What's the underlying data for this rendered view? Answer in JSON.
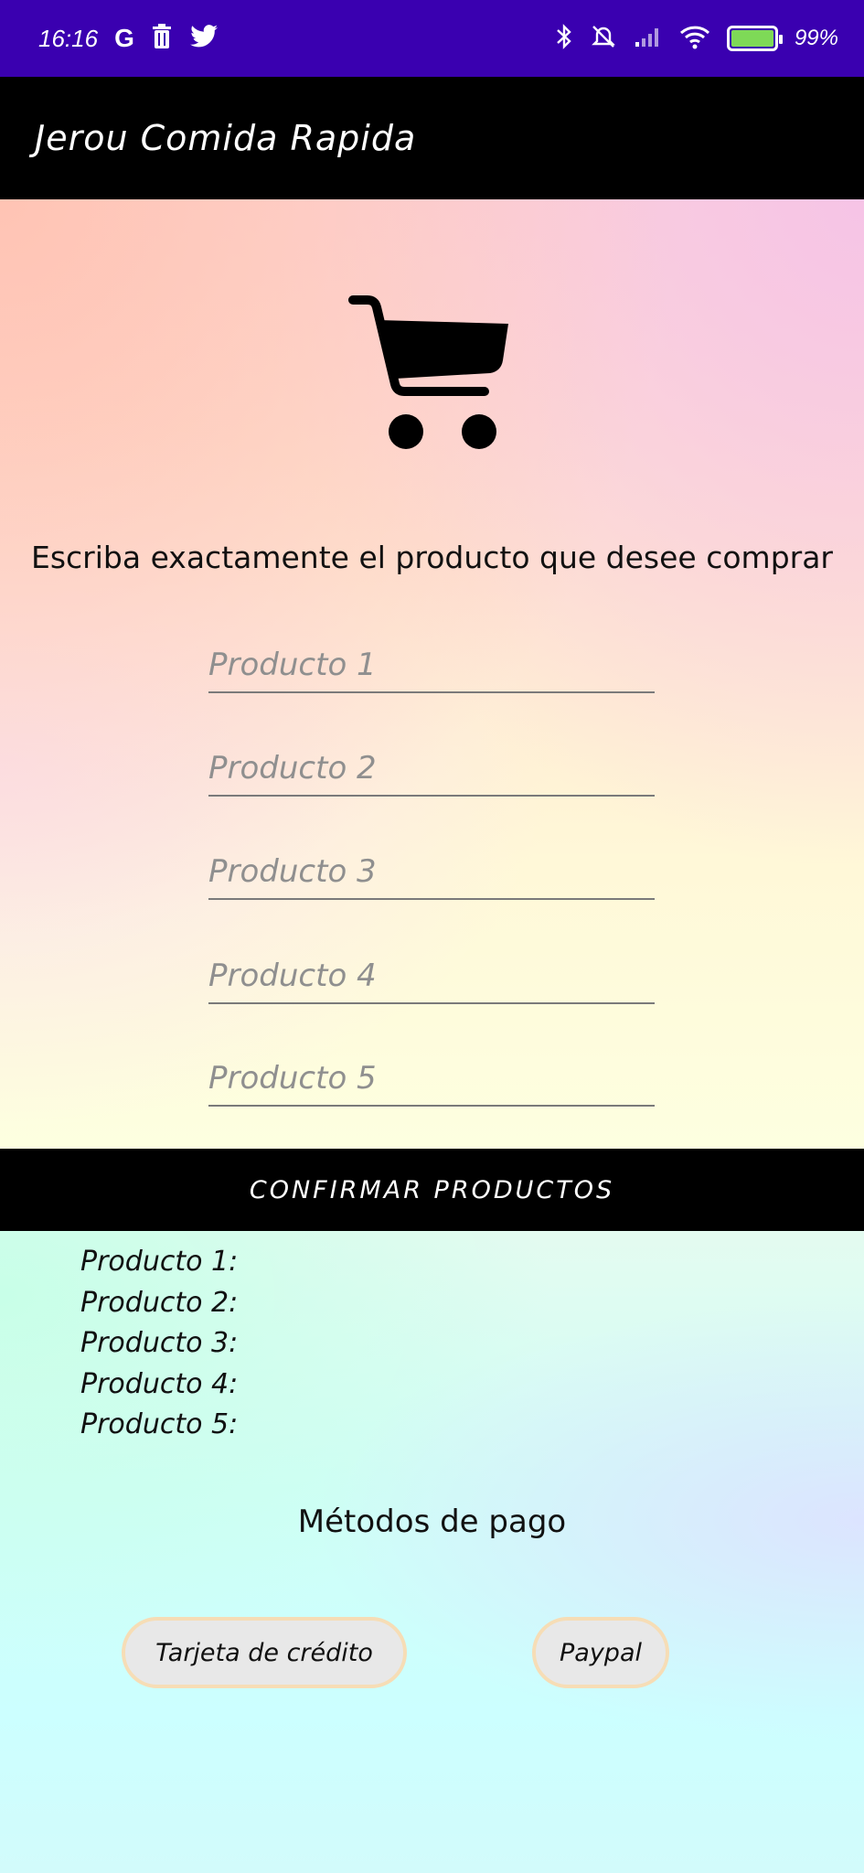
{
  "status_bar": {
    "time": "16:16",
    "notif_icons": [
      "G",
      "trash-icon",
      "twitter-icon"
    ],
    "battery": "99%",
    "battery_color": "#7ed957",
    "bg_color": "#3a00b0"
  },
  "app_bar": {
    "title": "Jerou Comida Rapida"
  },
  "main": {
    "instruction": "Escriba exactamente el producto que desee comprar",
    "fields": [
      {
        "placeholder": "Producto 1",
        "value": ""
      },
      {
        "placeholder": "Producto 2",
        "value": ""
      },
      {
        "placeholder": "Producto 3",
        "value": ""
      },
      {
        "placeholder": "Producto 4",
        "value": ""
      },
      {
        "placeholder": "Producto 5",
        "value": ""
      }
    ],
    "confirm_label": "CONFIRMAR PRODUCTOS"
  },
  "summary": {
    "lines": [
      "Producto 1:",
      "Producto 2:",
      "Producto 3:",
      "Producto 4:",
      "Producto 5:"
    ]
  },
  "payment": {
    "heading": "Métodos de pago",
    "credit_card_label": "Tarjeta de crédito",
    "paypal_label": "Paypal"
  }
}
